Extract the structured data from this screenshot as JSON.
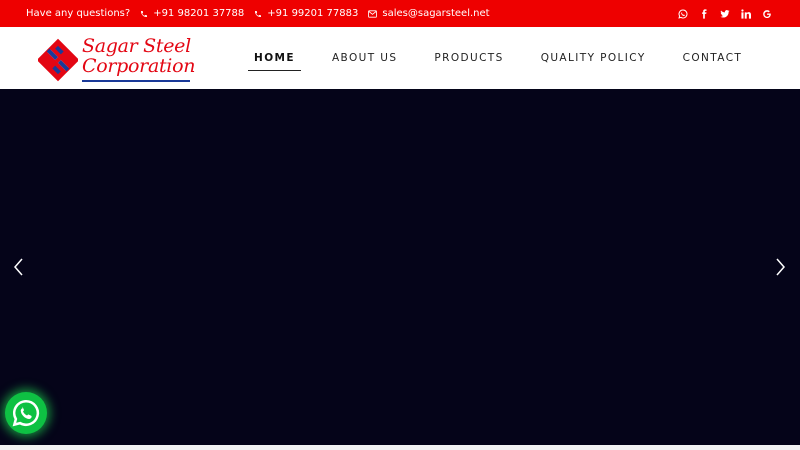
{
  "topbar": {
    "question": "Have any questions?",
    "phone1": "+91 98201 37788",
    "phone2": "+91 99201 77883",
    "email": "sales@sagarsteel.net",
    "social_icons": [
      "whatsapp-icon",
      "facebook-icon",
      "twitter-icon",
      "linkedin-icon",
      "google-icon"
    ],
    "background_color": "#ee0000"
  },
  "logo": {
    "line1": "Sagar Steel",
    "line2": "Corporation",
    "brand_red": "#e30613",
    "brand_blue": "#1a3a99"
  },
  "nav": {
    "items": [
      {
        "label": "HOME",
        "active": true
      },
      {
        "label": "ABOUT US",
        "active": false
      },
      {
        "label": "PRODUCTS",
        "active": false
      },
      {
        "label": "QUALITY POLICY",
        "active": false
      },
      {
        "label": "CONTACT",
        "active": false
      }
    ]
  },
  "hero": {
    "background_color": "#050419",
    "prev_icon": "chevron-left-icon",
    "next_icon": "chevron-right-icon"
  },
  "floating": {
    "whatsapp_icon": "whatsapp-icon",
    "color": "#0ec143"
  }
}
